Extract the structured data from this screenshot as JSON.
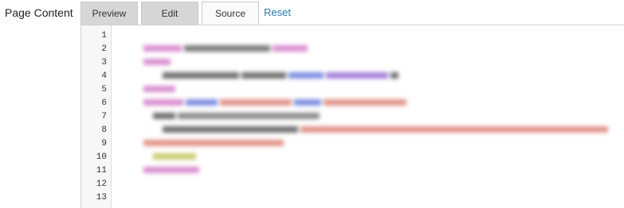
{
  "field": {
    "label": "Page Content"
  },
  "tabs": [
    {
      "label": "Preview"
    },
    {
      "label": "Edit"
    },
    {
      "label": "Source",
      "active": true
    }
  ],
  "reset_label": "Reset",
  "editor": {
    "line_numbers": [
      "1",
      "2",
      "3",
      "4",
      "5",
      "6",
      "7",
      "8",
      "9",
      "10",
      "11",
      "12",
      "13"
    ]
  },
  "colors": {
    "tag": "#d98fd0",
    "attr": "#7e8fe0",
    "string": "#e0948a",
    "text": "#6f6f6f",
    "comment": "#c9cc74",
    "link": "#2a7ab0"
  }
}
